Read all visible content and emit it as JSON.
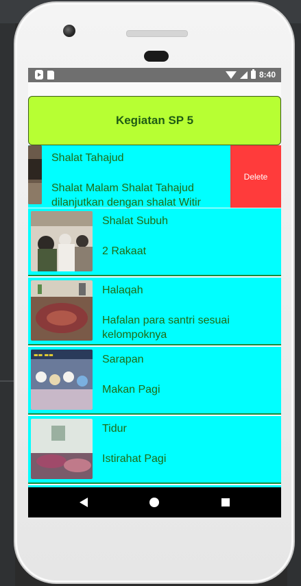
{
  "status_bar": {
    "time": "8:40",
    "icons": [
      "play-store-icon",
      "sd-card-icon",
      "wifi-icon",
      "signal-icon",
      "battery-icon"
    ]
  },
  "header": {
    "title": "Kegiatan SP 5"
  },
  "items": [
    {
      "title": "Shalat Tahajud",
      "description": "Shalat Malam Shalat Tahajud dilanjutkan dengan shalat Witir",
      "swiped": true,
      "action": "Delete"
    },
    {
      "title": "Shalat Subuh",
      "description": "2 Rakaat"
    },
    {
      "title": "Halaqah",
      "description": "Hafalan para santri sesuai kelompoknya"
    },
    {
      "title": "Sarapan",
      "description": "Makan Pagi"
    },
    {
      "title": "Tidur",
      "description": "Istirahat Pagi"
    }
  ],
  "colors": {
    "header_bg": "#b7ff33",
    "row_bg": "#00ffff",
    "text_green": "#1f6b14",
    "delete_bg": "#ff3b3b"
  },
  "nav": {
    "icons": [
      "back-icon",
      "home-icon",
      "recents-icon"
    ]
  }
}
